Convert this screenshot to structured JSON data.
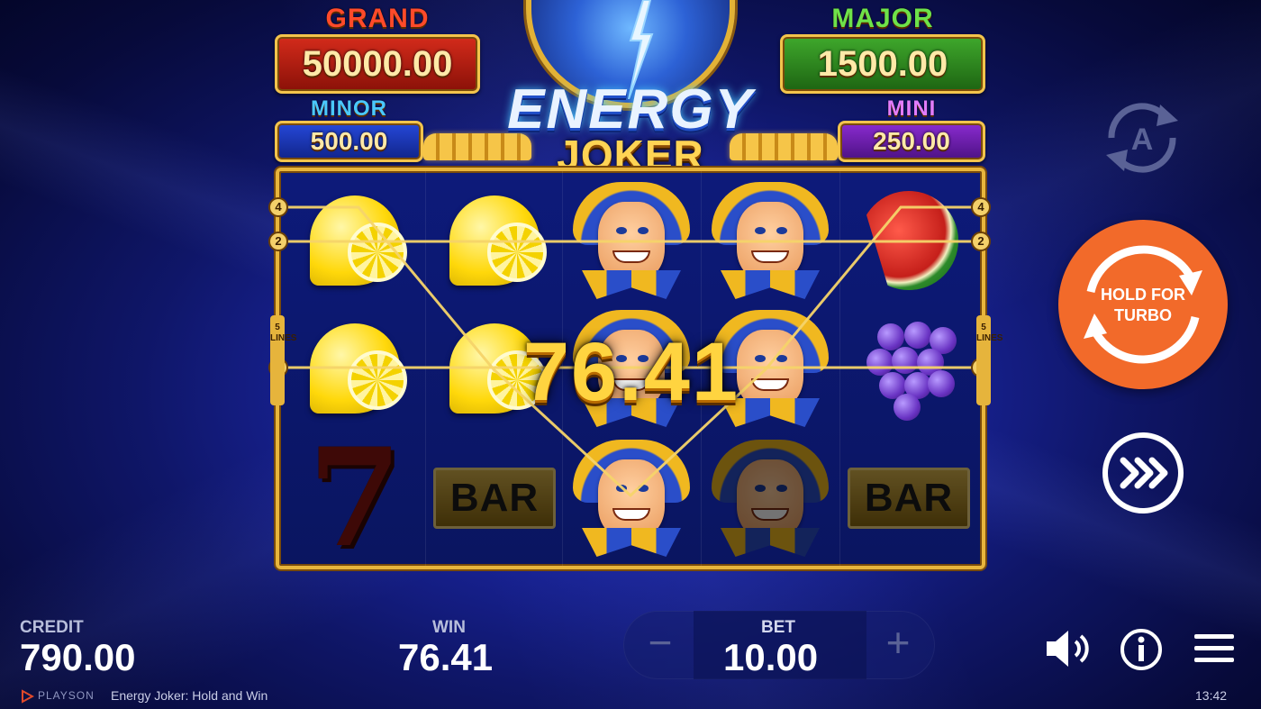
{
  "game": {
    "logo_title": "ENERGY",
    "logo_sub": "JOKER"
  },
  "jackpots": {
    "grand": {
      "label": "GRAND",
      "value": "50000.00"
    },
    "major": {
      "label": "MAJOR",
      "value": "1500.00"
    },
    "minor": {
      "label": "MINOR",
      "value": "500.00"
    },
    "mini": {
      "label": "MINI",
      "value": "250.00"
    }
  },
  "reels": {
    "columns": [
      [
        "lemon",
        "lemon",
        "seven"
      ],
      [
        "lemon",
        "lemon",
        "bar"
      ],
      [
        "joker",
        "joker",
        "joker"
      ],
      [
        "joker",
        "joker",
        "joker-dim"
      ],
      [
        "watermelon",
        "grapes",
        "bar"
      ]
    ],
    "bar_label": "BAR",
    "seven_label": "7",
    "win_overlay": "76.41",
    "line_markers": [
      "4",
      "2",
      "1"
    ],
    "side_tag": "5 LINES"
  },
  "controls": {
    "autoplay_icon": "autoplay-icon",
    "turbo_label_1": "HOLD FOR",
    "turbo_label_2": "TURBO",
    "skip_icon": "fast-forward-icon"
  },
  "bottom_bar": {
    "credit_label": "CREDIT",
    "credit_value": "790.00",
    "win_label": "WIN",
    "win_value": "76.41",
    "bet_label": "BET",
    "bet_value": "10.00",
    "bet_minus": "−",
    "bet_plus": "+"
  },
  "footer": {
    "brand": "PLAYSON",
    "title": "Energy Joker: Hold and Win",
    "clock": "13:42"
  }
}
